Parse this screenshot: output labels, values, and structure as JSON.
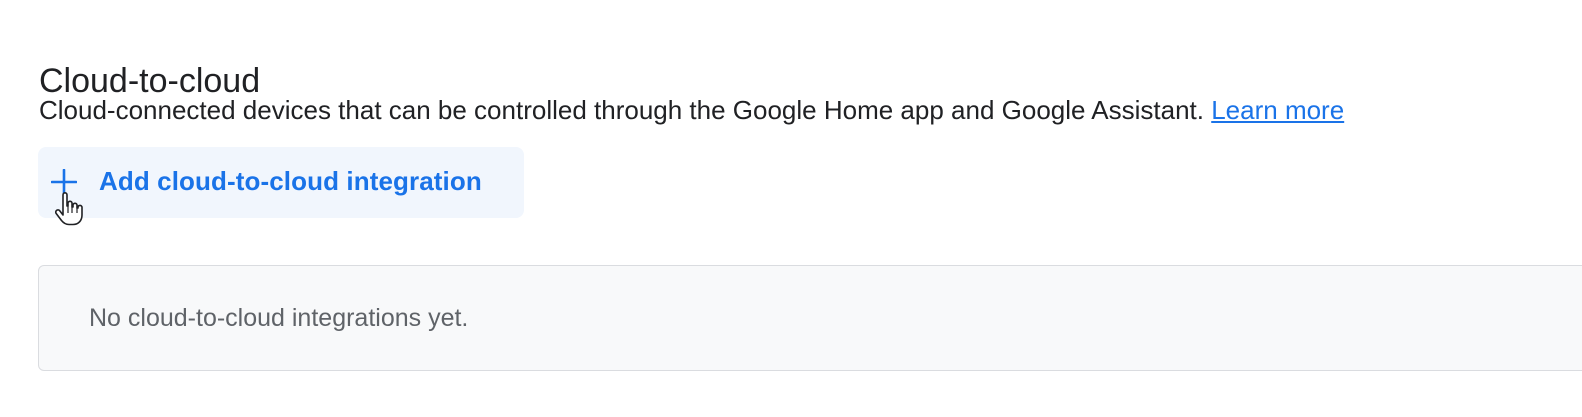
{
  "section": {
    "title": "Cloud-to-cloud",
    "description": "Cloud-connected devices that can be controlled through the Google Home app and Google Assistant.",
    "learn_more_label": "Learn more"
  },
  "add_button": {
    "label": "Add cloud-to-cloud integration",
    "icon": "plus-icon"
  },
  "cursor": {
    "icon": "hand-pointer-icon"
  },
  "empty_state": {
    "message": "No cloud-to-cloud integrations yet."
  },
  "colors": {
    "accent": "#1a73e8",
    "text_primary": "#202124",
    "text_secondary": "#5f6368",
    "button_bg": "#f1f6fd",
    "panel_bg": "#f8f9fa",
    "panel_border": "#dadce0"
  }
}
